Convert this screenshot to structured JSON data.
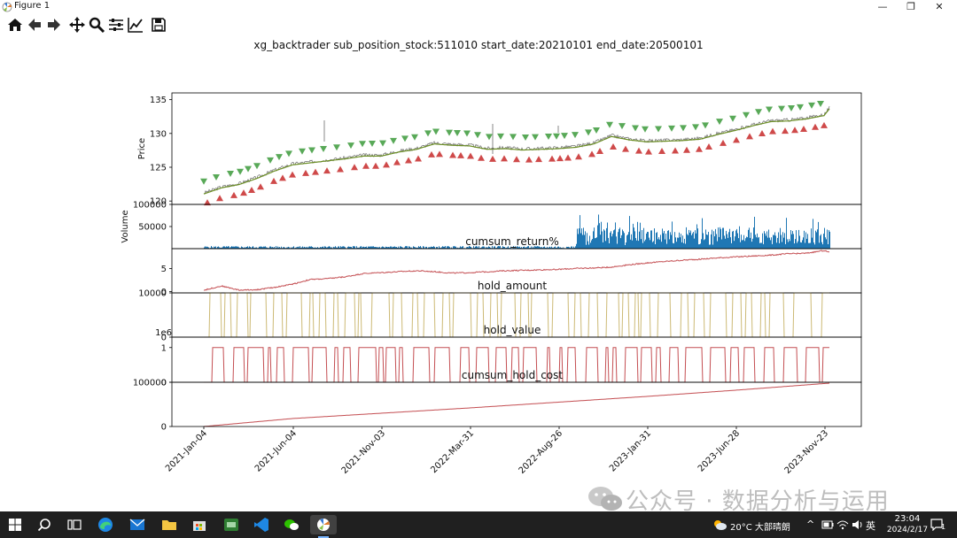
{
  "window": {
    "title": "Figure 1",
    "minimize": "—",
    "restore": "❐",
    "close": "✕"
  },
  "toolbar": {
    "buttons": [
      "home-icon",
      "back-icon",
      "forward-icon",
      "pan-icon",
      "zoom-icon",
      "configure-subplots-icon",
      "edit-axis-icon",
      "save-icon"
    ]
  },
  "figure": {
    "suptitle": "xg_backtrader sub_position_stock:511010 start_date:20210101 end_date:20500101",
    "x_ticks": [
      "2021-Jan-04",
      "2021-Jun-04",
      "2021-Nov-03",
      "2022-Mar-31",
      "2022-Aug-26",
      "2023-Jan-31",
      "2023-Jun-28",
      "2023-Nov-23"
    ]
  },
  "chart_data": [
    {
      "type": "line",
      "ylabel": "Price",
      "ylim": [
        119.5,
        136
      ],
      "yticks": [
        "120",
        "125",
        "130",
        "135"
      ],
      "series": [
        {
          "color": "#6b8e23"
        }
      ],
      "x": [
        0,
        20,
        40,
        60,
        80,
        100,
        120,
        140,
        160,
        180,
        200,
        220,
        240,
        260,
        280,
        300,
        320,
        340,
        360,
        380,
        400,
        420,
        440,
        460,
        480,
        500,
        520,
        540,
        560,
        580,
        600,
        620,
        640,
        660,
        680,
        700,
        706
      ],
      "values": [
        121.2,
        122.1,
        122.6,
        123.5,
        124.6,
        125.5,
        125.8,
        126.1,
        126.4,
        126.8,
        126.8,
        127.4,
        127.8,
        128.6,
        128.4,
        128.3,
        127.8,
        127.9,
        127.7,
        127.8,
        127.9,
        128.1,
        128.6,
        129.7,
        129.2,
        128.9,
        129.0,
        129.1,
        129.3,
        130.0,
        130.6,
        131.3,
        131.9,
        132.0,
        132.3,
        132.8,
        133.8
      ],
      "buy_color": "#59a958",
      "sell_color": "#cf4a4a"
    },
    {
      "type": "bar",
      "ylabel": "Volume",
      "ylim": [
        0,
        100000
      ],
      "yticks": [
        "50000",
        "100000"
      ],
      "color": "#1f77b4"
    },
    {
      "type": "line",
      "title": "cumsum_return%",
      "ylim": [
        -0.3,
        9.3
      ],
      "yticks": [
        "0",
        "5"
      ],
      "color": "#c44e52",
      "x": [
        0,
        20,
        40,
        60,
        80,
        100,
        120,
        140,
        160,
        180,
        200,
        220,
        240,
        260,
        280,
        300,
        320,
        340,
        360,
        380,
        400,
        420,
        440,
        460,
        480,
        500,
        520,
        540,
        560,
        580,
        600,
        620,
        640,
        660,
        680,
        700,
        706
      ],
      "values": [
        0.3,
        1.2,
        0.3,
        0.4,
        0.9,
        1.6,
        2.6,
        2.8,
        3.2,
        3.9,
        4.1,
        4.3,
        4.5,
        4.3,
        4.0,
        4.1,
        4.3,
        4.5,
        4.6,
        4.7,
        4.8,
        5.0,
        5.1,
        5.3,
        5.8,
        6.2,
        6.5,
        6.8,
        7.0,
        7.3,
        7.5,
        7.7,
        7.9,
        8.2,
        8.3,
        8.9,
        8.5
      ]
    },
    {
      "type": "step",
      "title": "hold_amount",
      "ylim": [
        0,
        10000
      ],
      "yticks": [
        "0",
        "10000"
      ],
      "color": "#ccb974",
      "seed": 7
    },
    {
      "type": "step",
      "title": "hold_value",
      "ylim": [
        0,
        1300000
      ],
      "yticks": [
        "0",
        "1"
      ],
      "offset_label": "1e6",
      "color": "#c44e52",
      "seed": 13
    },
    {
      "type": "line",
      "title": "cumsum_hold_cost",
      "ylim": [
        0,
        100000
      ],
      "yticks": [
        "0",
        "100000"
      ],
      "color": "#c44e52",
      "x": [
        0,
        100,
        200,
        300,
        400,
        500,
        600,
        706
      ],
      "values": [
        0,
        18000,
        30000,
        42000,
        55000,
        68000,
        82000,
        98000
      ]
    }
  ],
  "taskbar": {
    "weather": "20°C  大部晴朗",
    "ime": "英",
    "time": "23:04",
    "date": "2024/2/17",
    "notifications": "1"
  },
  "watermark": {
    "text": "公众号 · 数据分析与运用"
  }
}
